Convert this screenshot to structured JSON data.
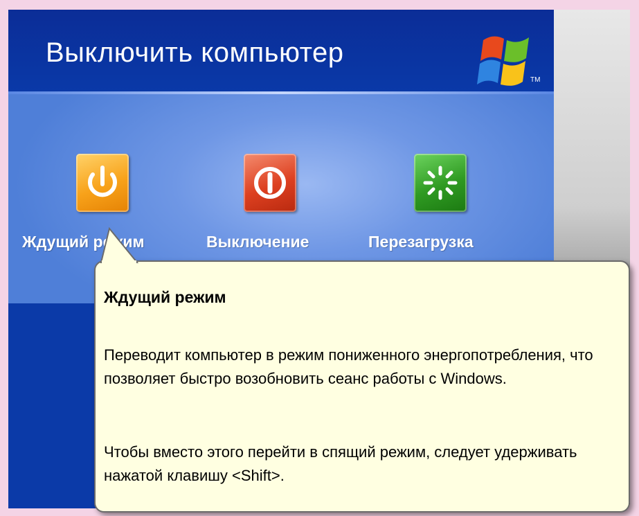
{
  "dialog": {
    "title": "Выключить компьютер",
    "logo_icon": "windows-flag-icon",
    "trademark": "TM"
  },
  "buttons": [
    {
      "label": "Ждущий режим",
      "icon": "power-standby-icon",
      "color": "#f8a21a"
    },
    {
      "label": "Выключение",
      "icon": "power-off-icon",
      "color": "#dd4020"
    },
    {
      "label": "Перезагрузка",
      "icon": "restart-icon",
      "color": "#2f9a22"
    }
  ],
  "tooltip": {
    "title": "Ждущий режим",
    "description": "Переводит компьютер в режим пониженного энергопотребления, что позволяет быстро возобновить сеанс работы с Windows.",
    "hint": "Чтобы вместо этого перейти в спящий режим, следует удерживать нажатой клавишу <Shift>."
  },
  "colors": {
    "header_blue": "#0b2d97",
    "panel_blue": "#6f97e5",
    "tooltip_bg": "#ffffe1",
    "page_pink": "#f4d4e6"
  }
}
